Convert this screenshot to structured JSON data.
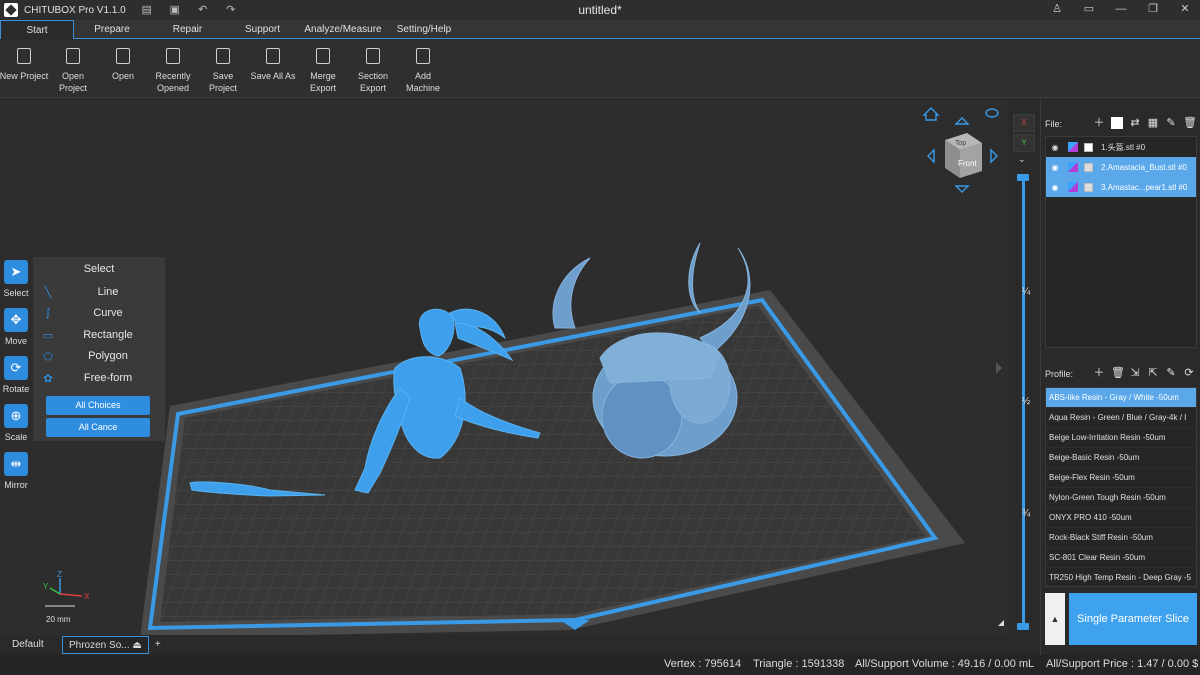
{
  "app": {
    "title": "CHITUBOX Pro V1.1.0",
    "document": "untitled*"
  },
  "tabs": [
    "Start",
    "Prepare",
    "Repair",
    "Support",
    "Analyze/Measure",
    "Setting/Help"
  ],
  "ribbon": {
    "new_project": "New Project",
    "open_project_1": "Open",
    "open_project_2": "Project",
    "open": "Open",
    "recently_1": "Recently",
    "recently_2": "Opened",
    "save_project": "Save Project",
    "save_all_as": "Save All As",
    "merge_1": "Merge",
    "merge_2": "Export",
    "section_1": "Section",
    "section_2": "Export",
    "add_1": "Add",
    "add_2": "Machine"
  },
  "left_tools": [
    "Select",
    "Move",
    "Rotate",
    "Scale",
    "Mirror"
  ],
  "select_panel": {
    "title": "Select",
    "options": [
      "Line",
      "Curve",
      "Rectangle",
      "Polygon",
      "Free-form"
    ],
    "all_choices": "All Choices",
    "all_cancel": "All Cance"
  },
  "viewport": {
    "scale_label": "20 mm",
    "cube_top": "Top",
    "cube_front": "Front",
    "axis_x": "X",
    "axis_y": "Y",
    "axis_z": "Z"
  },
  "bottom_tabs": {
    "default": "Default",
    "profile": "Phrozen So...",
    "add": "+"
  },
  "status": {
    "vertex": "Vertex : 795614",
    "triangle": "Triangle : 1591338",
    "volume": "All/Support Volume : 49.16 / 0.00 mL",
    "price": "All/Support Price : 1.47 / 0.00 $"
  },
  "slider": {
    "x_btn": "X",
    "y_btn": "Y",
    "q1": "¼",
    "q2": "½",
    "q3": "¾"
  },
  "file_panel": {
    "label": "File:",
    "files": [
      {
        "name": "1.头盔.stl #0",
        "selected": false
      },
      {
        "name": "2.Amastacia_Bust.stl #0",
        "selected": true
      },
      {
        "name": "3.Amastac...pear1.stl #0",
        "selected": true
      }
    ]
  },
  "profile_panel": {
    "label": "Profile:",
    "profiles": [
      "ABS-like Resin - Gray / White -50um",
      "Aqua Resin - Green / Blue / Gray-4k / I",
      "Beige Low-Irritation Resin -50um",
      "Beige-Basic Resin -50um",
      "Beige-Flex Resin -50um",
      "Nylon-Green Tough Resin -50um",
      "ONYX PRO 410 -50um",
      "Rock-Black Stiff Resin -50um",
      "SC-801 Clear Resin -50um",
      "TR250 High Temp Resin - Deep Gray -5"
    ]
  },
  "slice_button": "Single Parameter Slice",
  "colors": {
    "accent": "#2f8de0",
    "model": "#3ea0ec",
    "selected_row": "#5aa7ea"
  }
}
